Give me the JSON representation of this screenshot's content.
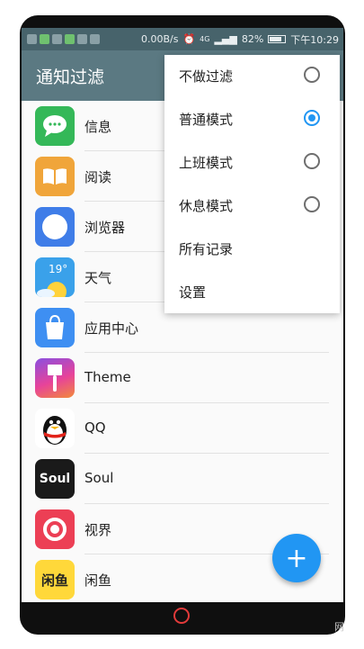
{
  "status_bar": {
    "network_speed": "0.00B/s",
    "network_type": "4G",
    "battery_percent": "82%",
    "battery_level": 0.82,
    "time": "下午10:29"
  },
  "app_bar": {
    "title": "通知过滤"
  },
  "apps": [
    {
      "label": "信息",
      "icon": "message-bubble-icon",
      "color": "#34b858"
    },
    {
      "label": "阅读",
      "icon": "book-icon",
      "color": "#f0a53a"
    },
    {
      "label": "浏览器",
      "icon": "compass-icon",
      "color": "#3f7de8"
    },
    {
      "label": "天气",
      "icon": "sun-icon",
      "text": "19°",
      "color": "#3aa1ea"
    },
    {
      "label": "应用中心",
      "icon": "shopping-bag-icon",
      "color": "#3e8ff2"
    },
    {
      "label": "Theme",
      "icon": "paint-brush-icon",
      "color": "#e7439a"
    },
    {
      "label": "QQ",
      "icon": "penguin-icon",
      "color": "#1d1d1d"
    },
    {
      "label": "Soul",
      "icon": "soul-logo-icon",
      "text": "Soul",
      "color": "#1a1a1a"
    },
    {
      "label": "视界",
      "icon": "eye-ring-icon",
      "color": "#ec3f55"
    },
    {
      "label": "闲鱼",
      "icon": "xianyu-logo-icon",
      "text": "闲鱼",
      "color": "#ffd83a"
    }
  ],
  "menu": {
    "items": [
      {
        "label": "不做过滤",
        "radio": true,
        "selected": false
      },
      {
        "label": "普通模式",
        "radio": true,
        "selected": true
      },
      {
        "label": "上班模式",
        "radio": true,
        "selected": false
      },
      {
        "label": "休息模式",
        "radio": true,
        "selected": false
      },
      {
        "label": "所有记录",
        "radio": false,
        "selected": false
      },
      {
        "label": "设置",
        "radio": false,
        "selected": false
      }
    ]
  },
  "fab": {
    "icon": "plus-icon",
    "label": "+"
  },
  "colors": {
    "accent": "#2196f3",
    "appbar": "#5b7982",
    "statusbar": "#47636b"
  }
}
